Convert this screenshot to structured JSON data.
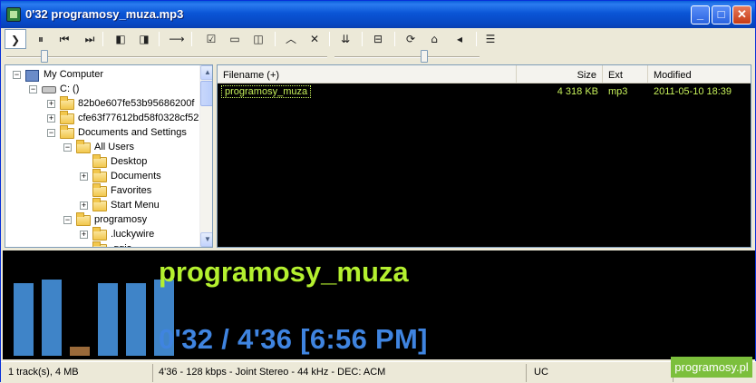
{
  "window": {
    "title": "0'32 programosy_muza.mp3",
    "minimize_label": "_",
    "maximize_label": "□",
    "close_label": "✕"
  },
  "toolbar": {
    "tools": [
      {
        "icon": "play-icon",
        "glyph": "❯"
      },
      {
        "icon": "pause-play-icon",
        "glyph": "⏸"
      },
      {
        "icon": "previous-track-icon",
        "glyph": "⏮"
      },
      {
        "icon": "next-track-icon",
        "glyph": "⏭"
      },
      {
        "icon": "open-folder-back-icon",
        "glyph": "◧"
      },
      {
        "icon": "open-folder-forward-icon",
        "glyph": "◨"
      },
      {
        "icon": "arrow-right-icon",
        "glyph": "⟶"
      },
      {
        "icon": "checklist-icon",
        "glyph": "☑"
      },
      {
        "icon": "window-icon",
        "glyph": "▭"
      },
      {
        "icon": "panel-icon",
        "glyph": "◫"
      },
      {
        "icon": "chevron-up-icon",
        "glyph": "︿"
      },
      {
        "icon": "close-icon",
        "glyph": "✕"
      },
      {
        "icon": "sort-down-icon",
        "glyph": "⇊"
      },
      {
        "icon": "split-view-icon",
        "glyph": "⊟"
      },
      {
        "icon": "refresh-icon",
        "glyph": "⟳"
      },
      {
        "icon": "home-icon",
        "glyph": "⌂"
      },
      {
        "icon": "volume-icon",
        "glyph": "◂"
      },
      {
        "icon": "properties-icon",
        "glyph": "☰"
      }
    ]
  },
  "sliders": {
    "position_fraction": 0.12,
    "volume_fraction": 0.62
  },
  "tree": {
    "items": [
      {
        "label": "My Computer",
        "kind": "computer",
        "expander": "−"
      },
      {
        "label": "C: ()",
        "kind": "drive",
        "expander": "−"
      },
      {
        "label": "82b0e607fe53b95686200f",
        "kind": "folder",
        "expander": "+"
      },
      {
        "label": "cfe63f77612bd58f0328cf52",
        "kind": "folder",
        "expander": "+"
      },
      {
        "label": "Documents and Settings",
        "kind": "folder",
        "expander": "−"
      },
      {
        "label": "All Users",
        "kind": "folder",
        "expander": "−"
      },
      {
        "label": "Desktop",
        "kind": "folder",
        "expander": ""
      },
      {
        "label": "Documents",
        "kind": "folder",
        "expander": "+"
      },
      {
        "label": "Favorites",
        "kind": "folder",
        "expander": ""
      },
      {
        "label": "Start Menu",
        "kind": "folder",
        "expander": "+"
      },
      {
        "label": "programosy",
        "kind": "folder",
        "expander": "−"
      },
      {
        "label": ".luckywire",
        "kind": "folder",
        "expander": "+"
      },
      {
        "label": ".ggis",
        "kind": "folder",
        "expander": ""
      }
    ],
    "scroll_up": "▲",
    "scroll_down": "▼"
  },
  "filelist": {
    "columns": {
      "filename": "Filename (+)",
      "size": "Size",
      "ext": "Ext",
      "modified": "Modified"
    },
    "rows": [
      {
        "filename": "programosy_muza",
        "size": "4 318 KB",
        "ext": "mp3",
        "modified": "2011-05-10 18:39"
      }
    ]
  },
  "now_playing": {
    "title": "programosy_muza",
    "time": "0'32 / 4'36    [6:56 PM]",
    "spectrum_levels": [
      0.89,
      0.93,
      0.11,
      0.89,
      0.89,
      0.93
    ],
    "bar_color": "#3f84c8",
    "low_bar_color": "#9a6a3a",
    "title_color": "#b4f02f",
    "time_color": "#3f84e0"
  },
  "status": {
    "tracks": "1 track(s), 4 MB",
    "format": "4'36 - 128 kbps - Joint Stereo - 44 kHz - DEC: ACM",
    "empty": "",
    "mode": "UC"
  },
  "watermark": "programosy.pl"
}
